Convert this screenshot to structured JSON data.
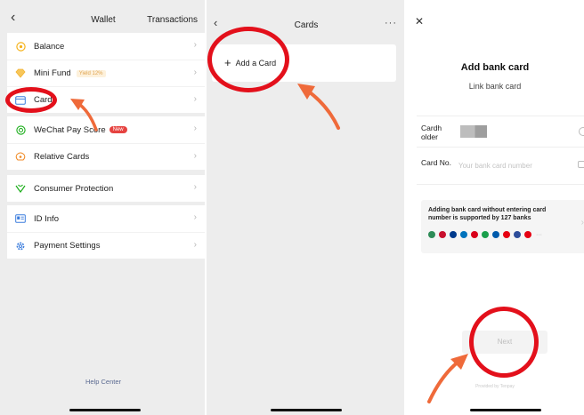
{
  "wallet": {
    "back_icon": "chevron-left-icon",
    "title": "Wallet",
    "transactions_label": "Transactions",
    "groups": [
      {
        "items": [
          {
            "label": "Balance",
            "icon": "coin-icon",
            "icon_color": "#f5b21a"
          },
          {
            "label": "Mini Fund",
            "icon": "diamond-icon",
            "icon_color": "#f2b230",
            "tag": "Yield 12%"
          },
          {
            "label": "Cards",
            "icon": "card-icon",
            "icon_color": "#3b7ddd"
          }
        ]
      },
      {
        "items": [
          {
            "label": "WeChat Pay Score",
            "icon": "score-icon",
            "icon_color": "#1aad19",
            "badge": "New"
          },
          {
            "label": "Relative Cards",
            "icon": "relative-card-icon",
            "icon_color": "#f08a24"
          }
        ]
      },
      {
        "items": [
          {
            "label": "Consumer Protection",
            "icon": "shield-icon",
            "icon_color": "#1aad19"
          }
        ]
      },
      {
        "items": [
          {
            "label": "ID Info",
            "icon": "id-card-icon",
            "icon_color": "#3b7ddd"
          },
          {
            "label": "Payment Settings",
            "icon": "gear-icon",
            "icon_color": "#3b7ddd"
          }
        ]
      }
    ],
    "help_center": "Help Center"
  },
  "cards": {
    "back_icon": "chevron-left-icon",
    "title": "Cards",
    "more_icon": "more-dots-icon",
    "add_card_label": "Add a Card"
  },
  "add_bank_card": {
    "close_icon": "close-icon",
    "title": "Add bank card",
    "subtitle": "Link bank card",
    "cardholder_label": "Cardh older",
    "card_no_label": "Card No.",
    "card_no_placeholder": "Your bank card number",
    "banner_text": "Adding bank card without entering card number is supported by 127 banks",
    "bank_colors": [
      "#2e8b57",
      "#c8102e",
      "#003a8c",
      "#0072bc",
      "#d9001b",
      "#1a9f4b",
      "#005bac",
      "#e60012",
      "#2d4d9a",
      "#e60012"
    ],
    "next_label": "Next",
    "provided_by": "Provided by Tenpay"
  },
  "annotation": {
    "color": "#e3101b",
    "arrow_color": "#ef6a3a"
  }
}
